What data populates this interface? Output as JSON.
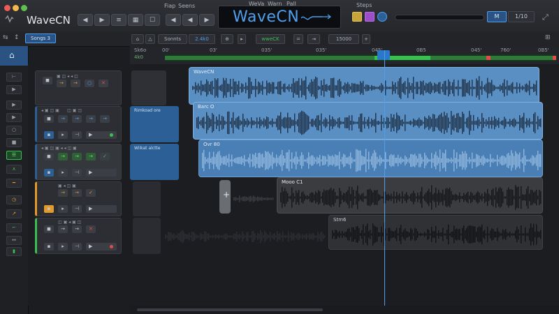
{
  "app": {
    "title": "WaveCN",
    "session_tab": "Songs 3",
    "lcd_title": "WaveCN"
  },
  "menu": {
    "left": [
      "Fiap",
      "Seens"
    ],
    "right": [
      "WeVa",
      "Warn",
      "Pall"
    ],
    "far_right": "Steps"
  },
  "transport": {
    "m_label": "M",
    "counter": "1/10"
  },
  "toolbar2": {
    "items": [
      "Sonnts",
      "2.4k0",
      "wweCK",
      "15000"
    ],
    "ruler_top": [
      "Sk6o",
      "4k0"
    ],
    "ticks": [
      "00'",
      "03'",
      "035'",
      "035'",
      "045'",
      "0B5",
      "045'",
      "760'",
      "0B5'"
    ]
  },
  "tracks": [
    {
      "header_label": "",
      "clip_label": "WaveCN",
      "region_label": ""
    },
    {
      "header_label": "",
      "clip_label": "Barc O",
      "region_label": "Rimkoad ore"
    },
    {
      "header_label": "",
      "clip_label": "Ovr 80",
      "region_label": "Wiikat alctte"
    },
    {
      "header_label": "",
      "clip_label": "Mooo C1",
      "region_label": ""
    },
    {
      "header_label": "",
      "clip_label": "Stm6",
      "region_label": ""
    }
  ],
  "colors": {
    "accent": "#4ea0ee",
    "clip_blue": "#5a8fc4",
    "clip_gray": "#3a3c40",
    "track_orange": "#e39a2b",
    "track_green": "#3cbf52"
  }
}
